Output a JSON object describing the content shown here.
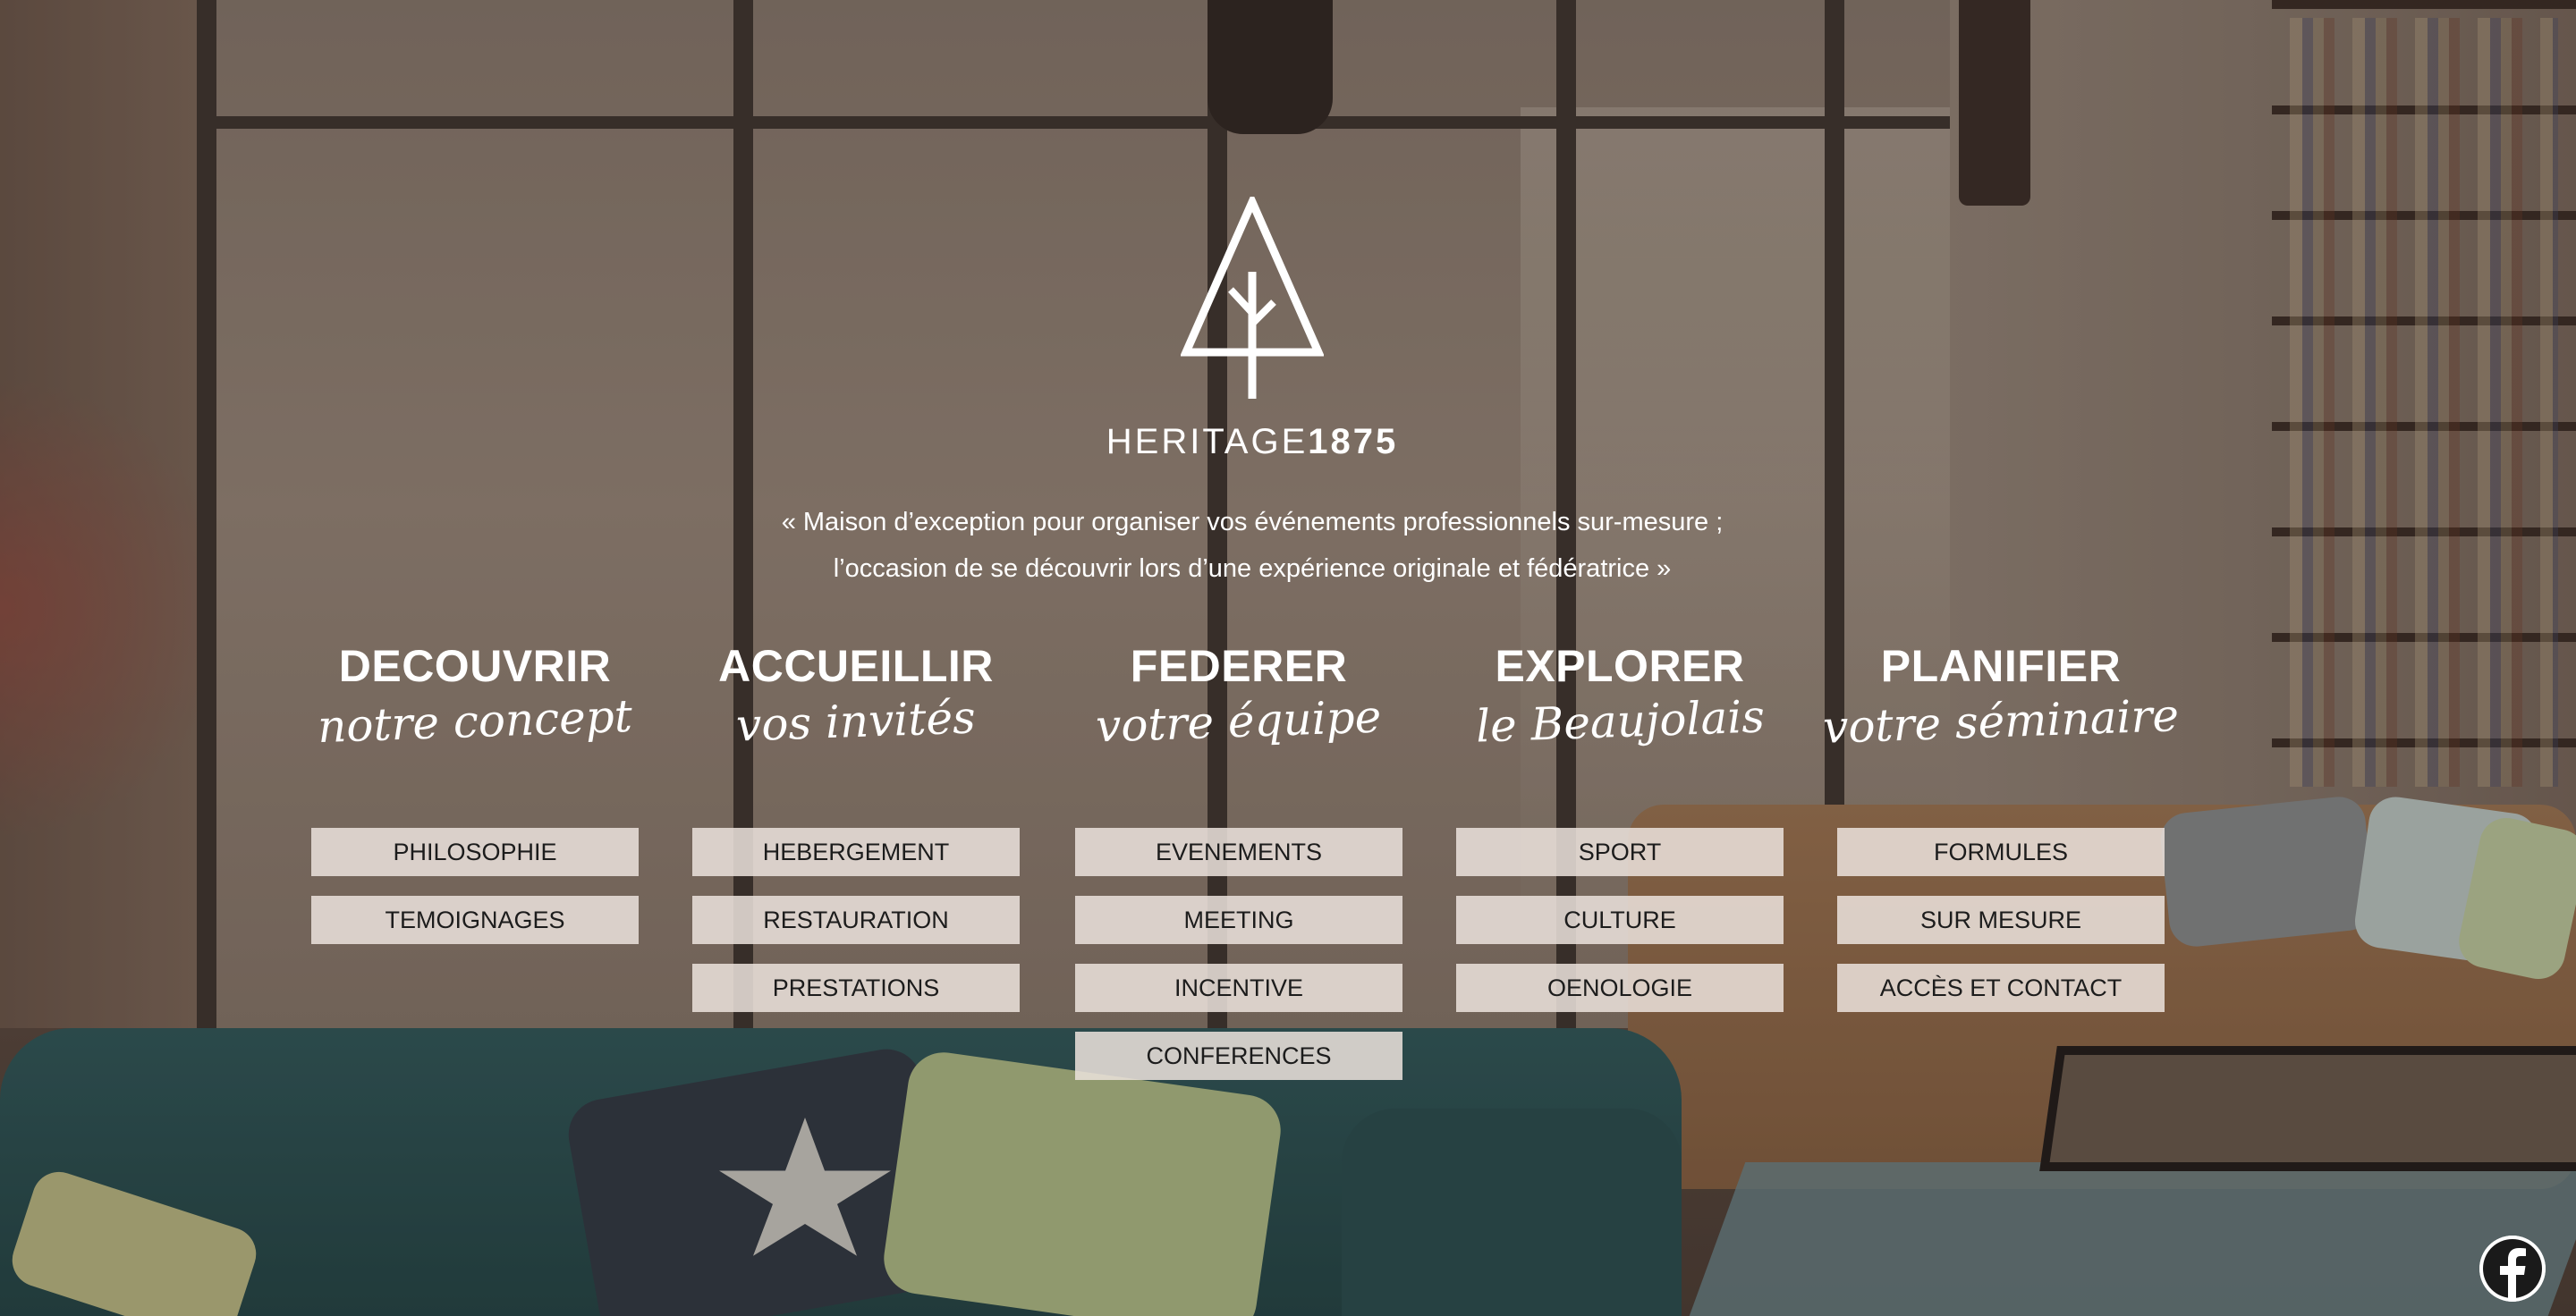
{
  "brand": {
    "name_light": "HERITAGE",
    "name_bold": "1875"
  },
  "tagline": {
    "line1": "« Maison d’exception pour organiser vos événements professionnels sur-mesure ;",
    "line2": "l’occasion de se découvrir lors d’une expérience originale et fédératrice »"
  },
  "columns": [
    {
      "title": "DECOUVRIR",
      "subtitle": "notre concept",
      "buttons": [
        "PHILOSOPHIE",
        "TEMOIGNAGES"
      ]
    },
    {
      "title": "ACCUEILLIR",
      "subtitle": "vos invités",
      "buttons": [
        "HEBERGEMENT",
        "RESTAURATION",
        "PRESTATIONS"
      ]
    },
    {
      "title": "FEDERER",
      "subtitle": "votre équipe",
      "buttons": [
        "EVENEMENTS",
        "MEETING",
        "INCENTIVE",
        "CONFERENCES"
      ]
    },
    {
      "title": "EXPLORER",
      "subtitle": "le Beaujolais",
      "buttons": [
        "SPORT",
        "CULTURE",
        "OENOLOGIE"
      ]
    },
    {
      "title": "PLANIFIER",
      "subtitle": "votre séminaire",
      "buttons": [
        "FORMULES",
        "SUR MESURE",
        "ACCÈS ET CONTACT"
      ]
    }
  ],
  "social": {
    "icon": "facebook-icon"
  }
}
